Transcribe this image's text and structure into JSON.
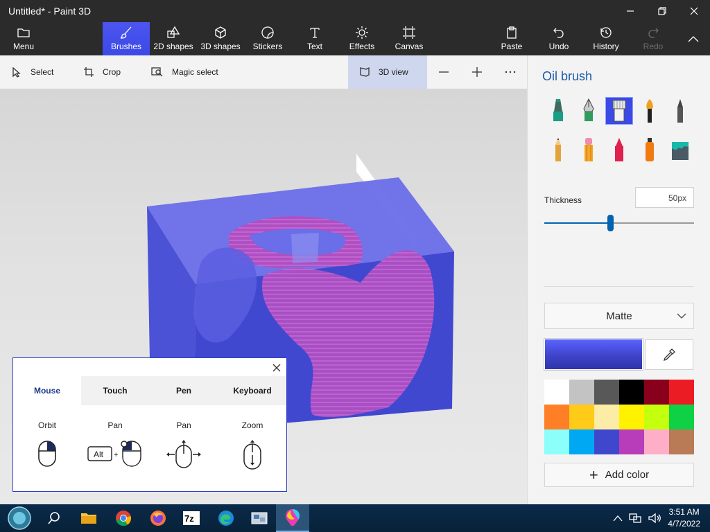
{
  "window": {
    "title": "Untitled* - Paint 3D"
  },
  "ribbon": {
    "menu": "Menu",
    "brushes": "Brushes",
    "shapes2d": "2D shapes",
    "shapes3d": "3D shapes",
    "stickers": "Stickers",
    "text": "Text",
    "effects": "Effects",
    "canvas": "Canvas",
    "paste": "Paste",
    "undo": "Undo",
    "history": "History",
    "redo": "Redo"
  },
  "toolbar": {
    "select": "Select",
    "crop": "Crop",
    "magic_select": "Magic select",
    "view3d": "3D view"
  },
  "help": {
    "tabs": [
      "Mouse",
      "Touch",
      "Pen",
      "Keyboard"
    ],
    "active_tab": "Mouse",
    "actions": [
      "Orbit",
      "Pan",
      "Pan",
      "Zoom"
    ],
    "alt_key": "Alt"
  },
  "panel": {
    "title": "Oil brush",
    "brushes": [
      "marker-icon",
      "calligraphy-pen-icon",
      "oil-brush-icon",
      "watercolor-icon",
      "pixel-pen-icon",
      "pencil-icon",
      "eraser-icon",
      "crayon-icon",
      "spray-can-icon",
      "fill-bucket-icon"
    ],
    "selected_brush": "oil-brush-icon",
    "thickness_label": "Thickness",
    "thickness_value": "50px",
    "thickness_fraction": 0.44,
    "finish": "Matte",
    "current_color": "#474fe0",
    "palette": [
      "#ffffff",
      "#c3c3c3",
      "#585858",
      "#000000",
      "#88001b",
      "#ec1c24",
      "#ff7f27",
      "#ffca18",
      "#fdeca6",
      "#fff200",
      "#c4ff0e",
      "#0ed145",
      "#8cfffb",
      "#00a8f3",
      "#3f48cc",
      "#b83dba",
      "#ffaec8",
      "#b97a56"
    ],
    "add_color": "Add color"
  },
  "taskbar": {
    "apps": [
      "start-icon",
      "search-icon",
      "file-explorer-icon",
      "chrome-icon",
      "firefox-icon",
      "7zip-icon",
      "edge-icon",
      "control-panel-icon",
      "paint3d-icon"
    ],
    "time": "3:51 AM",
    "date": "4/7/2022"
  }
}
